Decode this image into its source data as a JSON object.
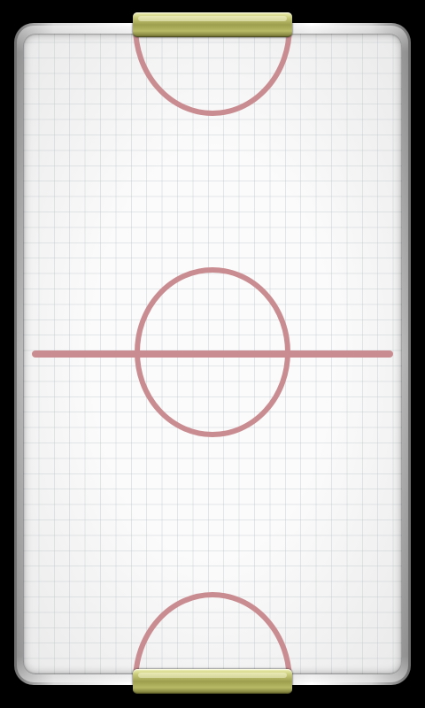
{
  "colors": {
    "background": "#000000",
    "rink_surface": "#fbfbfb",
    "grid_line": "#c6cfd3",
    "rink_line": "#c98c90",
    "goal": "#a9ab58",
    "frame": "#c8c8c8"
  },
  "icons": [
    "goal-top",
    "goal-bottom",
    "center-circle",
    "center-line",
    "goal-crease-top",
    "goal-crease-bottom"
  ]
}
